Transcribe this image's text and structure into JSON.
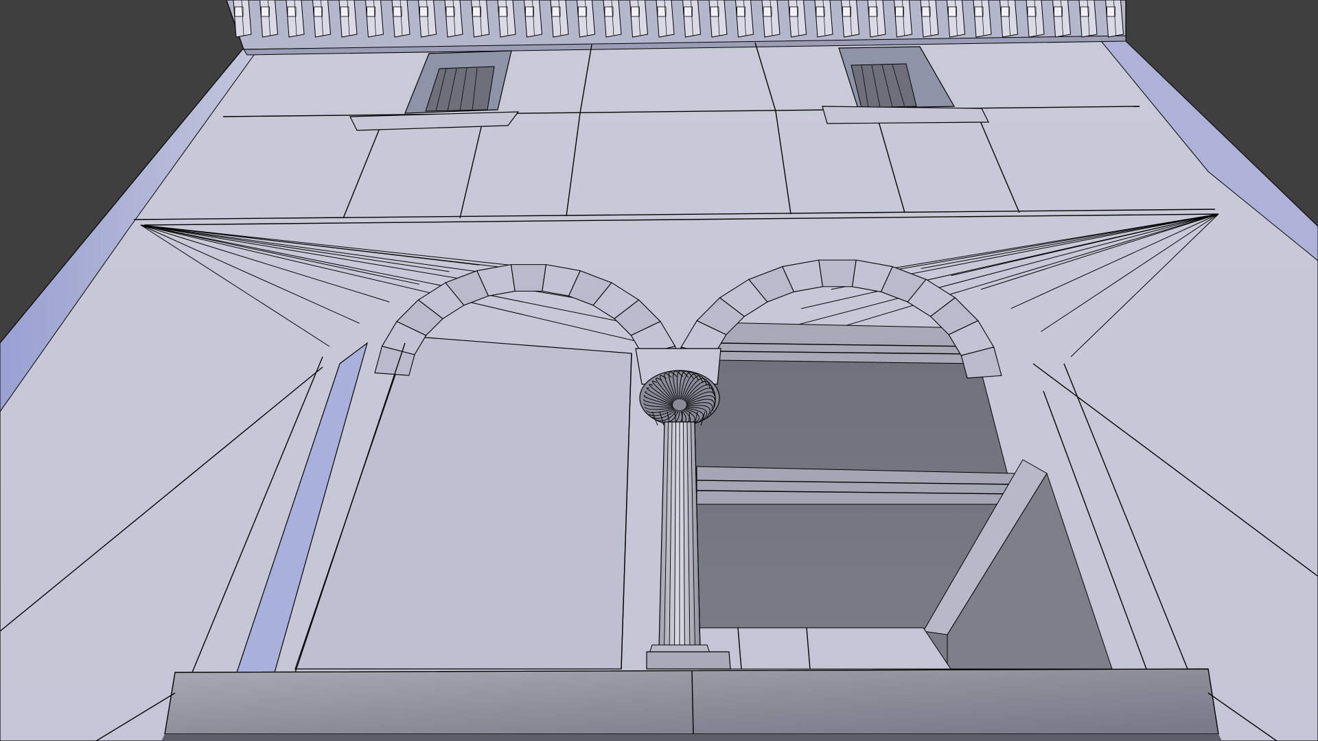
{
  "viewport": {
    "background_color": "#3f3f3f",
    "model_color": "#c6c7d8",
    "shadow_color": "#73757f",
    "edge_color": "#000000",
    "highlight_color": "#aab0dc"
  },
  "scene": {
    "subject": "building-facade-wireframe",
    "elements": [
      "cornice-icon",
      "upper-window-icon",
      "double-arch-icon",
      "corinthian-column-icon",
      "window-sill-icon"
    ]
  }
}
